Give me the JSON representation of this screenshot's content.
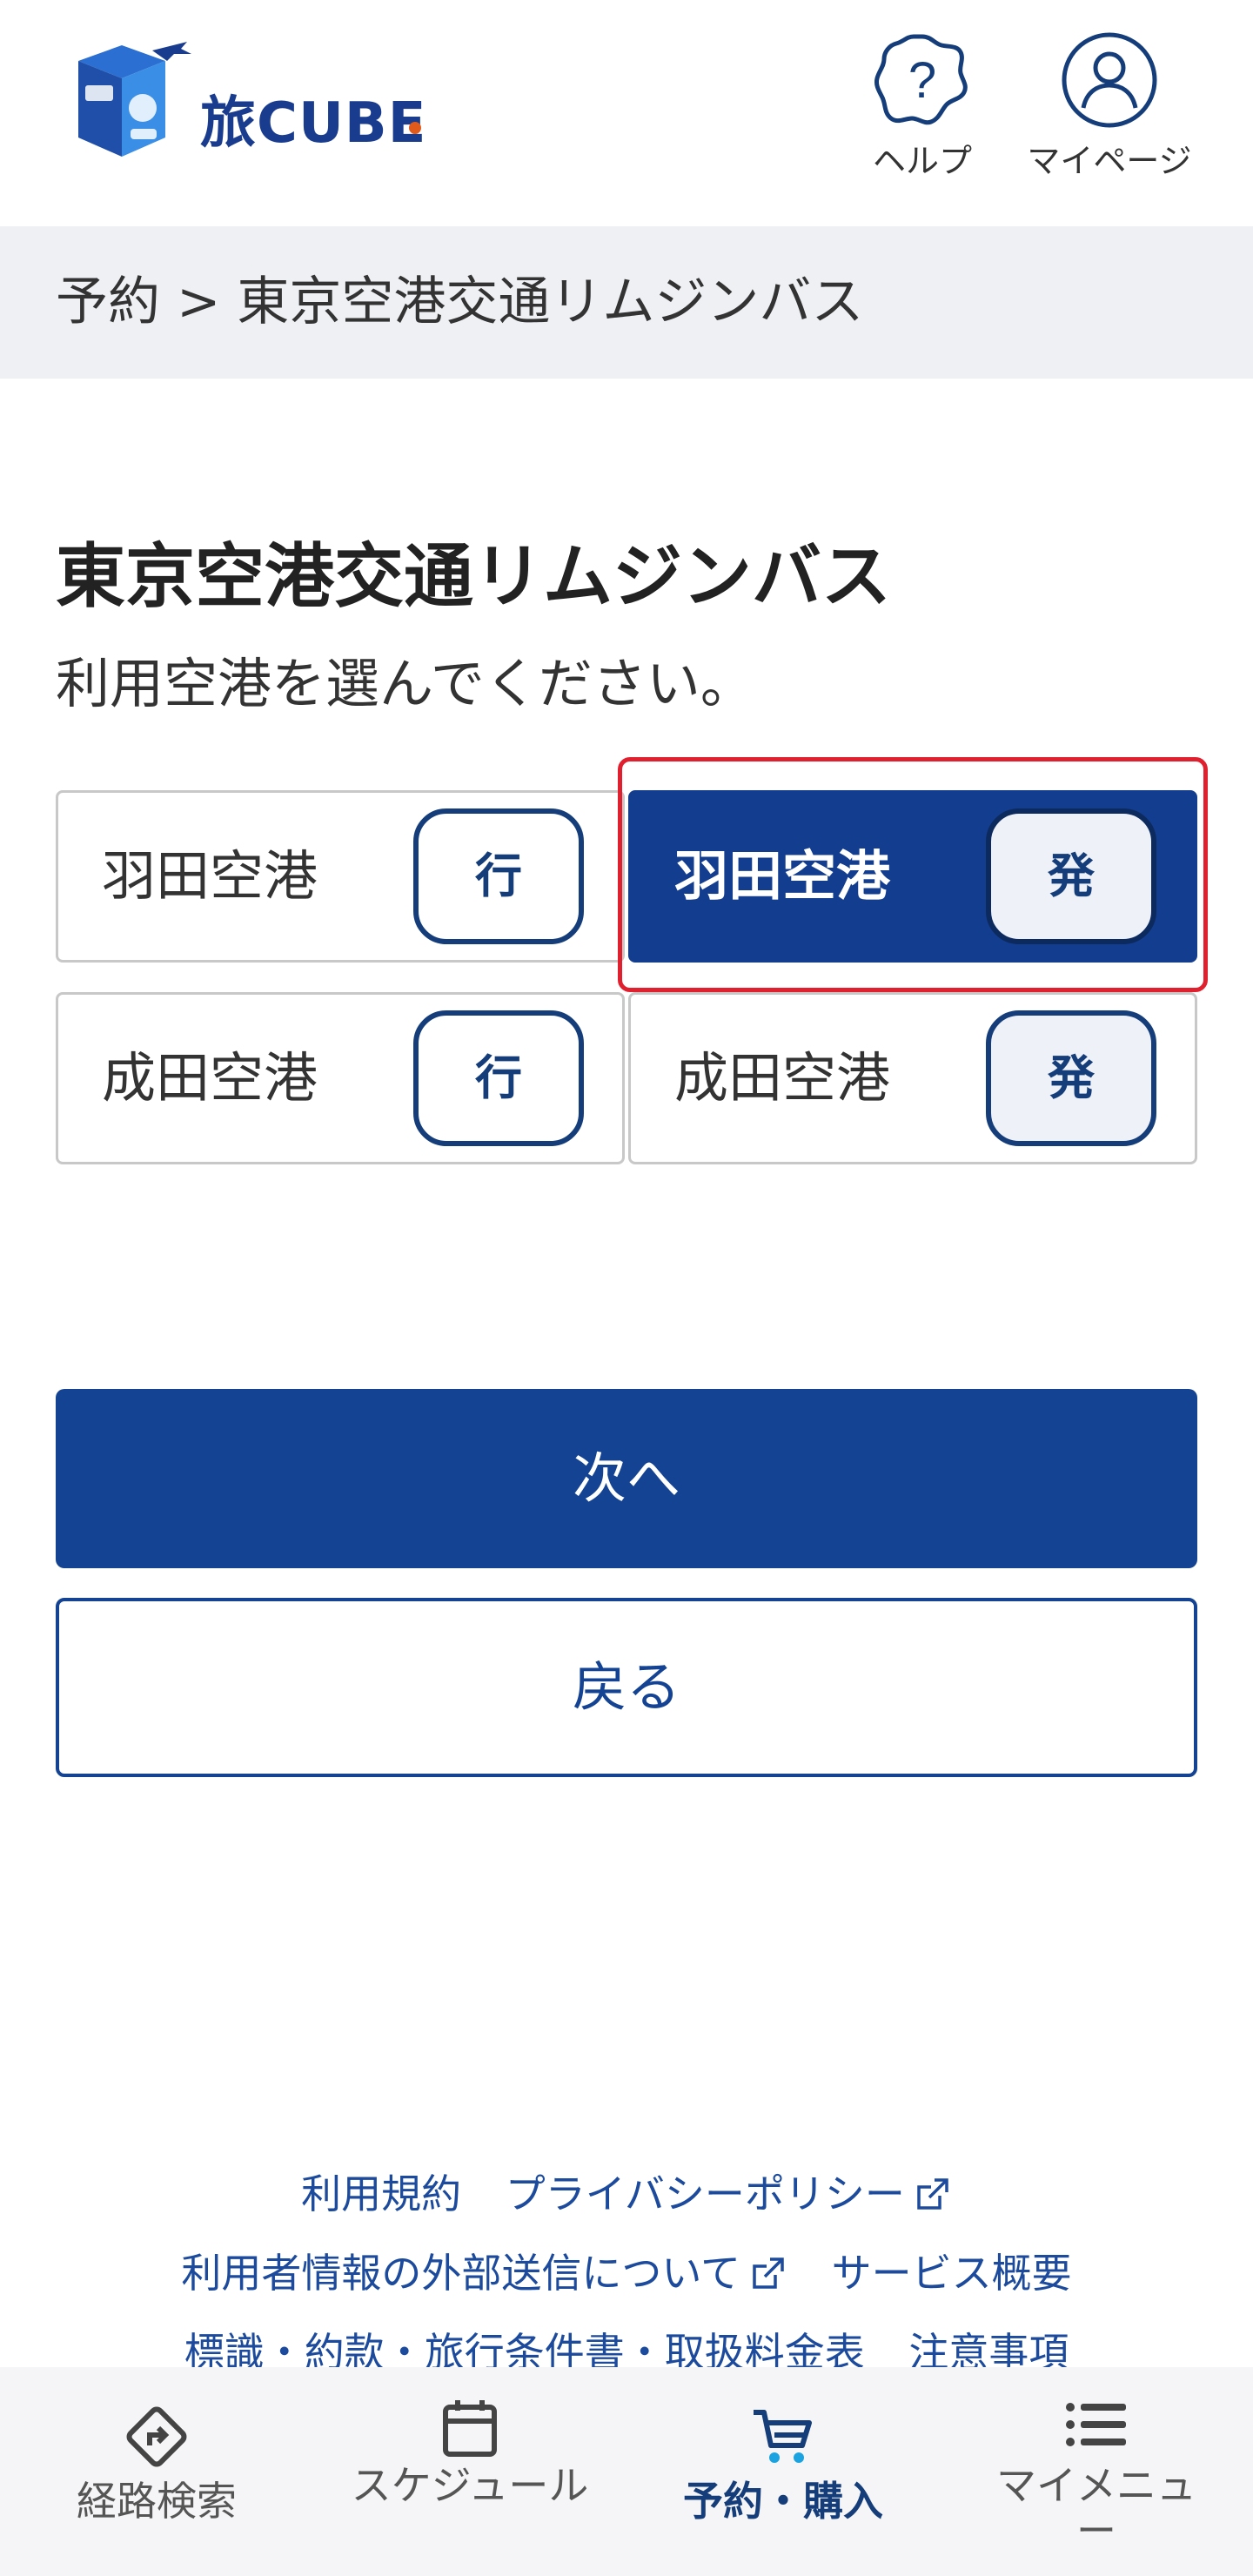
{
  "header": {
    "logo_text": "旅CUBE",
    "help_label": "ヘルプ",
    "mypage_label": "マイページ"
  },
  "breadcrumb": {
    "text": "予約 > 東京空港交通リムジンバス"
  },
  "main": {
    "title": "東京空港交通リムジンバス",
    "instruction": "利用空港を選んでください。",
    "options": [
      {
        "airport": "羽田空港",
        "direction": "行",
        "selected": false
      },
      {
        "airport": "羽田空港",
        "direction": "発",
        "selected": true
      },
      {
        "airport": "成田空港",
        "direction": "行",
        "selected": false
      },
      {
        "airport": "成田空港",
        "direction": "発",
        "selected": false
      }
    ],
    "next_label": "次へ",
    "back_label": "戻る"
  },
  "footer": {
    "terms": "利用規約",
    "privacy": "プライバシーポリシー",
    "external_info": "利用者情報の外部送信について",
    "service_overview": "サービス概要",
    "legal": "標識・約款・旅行条件書・取扱料金表",
    "notes": "注意事項"
  },
  "bottom_nav": {
    "items": [
      {
        "label": "経路検索",
        "icon": "route-icon",
        "active": false
      },
      {
        "label": "スケジュール",
        "icon": "calendar-icon",
        "active": false
      },
      {
        "label": "予約・購入",
        "icon": "cart-icon",
        "active": true
      },
      {
        "label": "マイメニュー",
        "icon": "menu-icon",
        "active": false
      }
    ]
  },
  "colors": {
    "primary": "#134392",
    "selected_outline": "#e0202f",
    "link": "#1c4a9c",
    "breadcrumb_bg": "#eef0f4"
  }
}
